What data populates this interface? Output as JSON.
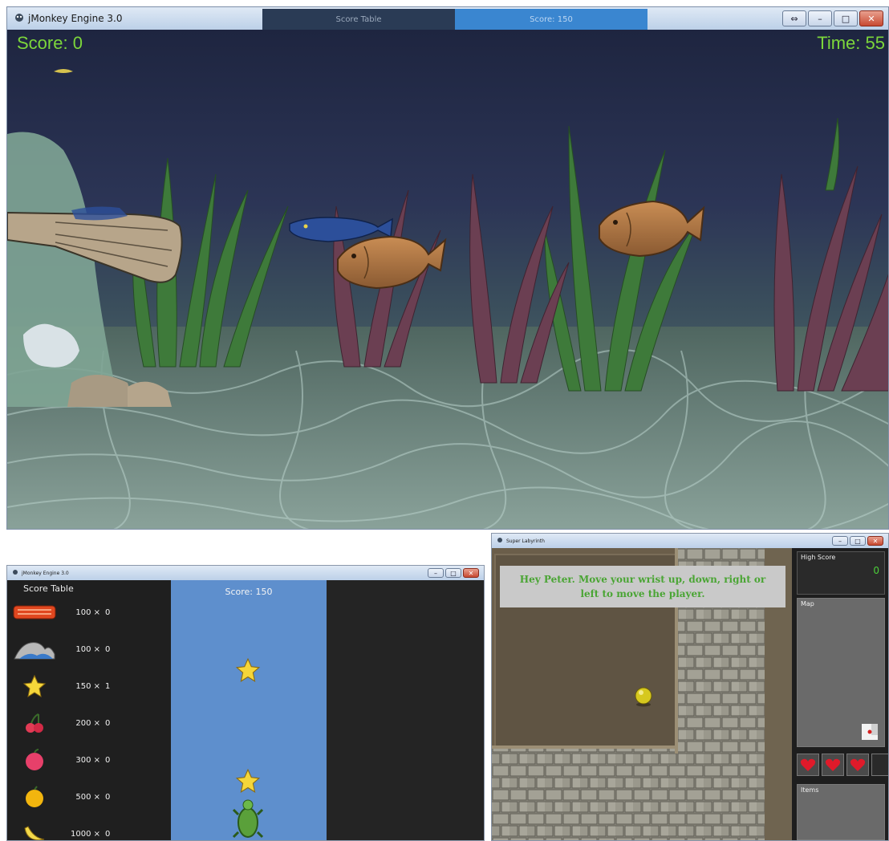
{
  "fish_window": {
    "title": "jMonkey Engine 3.0",
    "bg_tabs": [
      "Score Table",
      "Score: 150"
    ],
    "score": "Score: 0",
    "time": "Time: 55",
    "hud_color": "#7cd63b"
  },
  "score_table_window": {
    "title": "jMonkey Engine 3.0",
    "heading": "Score Table",
    "current_score": "Score: 150",
    "rows": [
      {
        "icon": "salmon-icon",
        "multiplier": "100 ×",
        "count": "0"
      },
      {
        "icon": "wave-icon",
        "multiplier": "100 ×",
        "count": "0"
      },
      {
        "icon": "star-icon",
        "multiplier": "150 ×",
        "count": "1"
      },
      {
        "icon": "cherry-icon",
        "multiplier": "200 ×",
        "count": "0"
      },
      {
        "icon": "apple-icon",
        "multiplier": "300 ×",
        "count": "0"
      },
      {
        "icon": "orange-icon",
        "multiplier": "500 ×",
        "count": "0"
      },
      {
        "icon": "banana-icon",
        "multiplier": "1000 ×",
        "count": "0"
      }
    ]
  },
  "maze_window": {
    "title": "Super Labyrinth",
    "message_line1": "Hey Peter. Move your wrist up, down, right or",
    "message_line2": "left to move the player.",
    "high_score_label": "High Score",
    "high_score_value": "0",
    "map_label": "Map",
    "items_label": "Items",
    "lives": 3,
    "life_slots": 4
  }
}
